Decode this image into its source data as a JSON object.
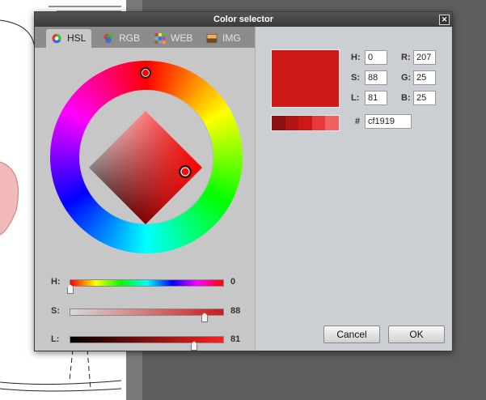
{
  "dialog": {
    "title": "Color selector",
    "close_label": "✕",
    "tabs": [
      {
        "label": "HSL",
        "active": true,
        "icon": "color-wheel-icon"
      },
      {
        "label": "RGB",
        "active": false,
        "icon": "rgb-circles-icon"
      },
      {
        "label": "WEB",
        "active": false,
        "icon": "web-palette-icon"
      },
      {
        "label": "IMG",
        "active": false,
        "icon": "image-icon"
      }
    ],
    "sliders": {
      "h": {
        "label": "H:",
        "value": "0"
      },
      "s": {
        "label": "S:",
        "value": "88"
      },
      "l": {
        "label": "L:",
        "value": "81"
      }
    },
    "fields": {
      "h": {
        "label": "H:",
        "value": "0"
      },
      "s": {
        "label": "S:",
        "value": "88"
      },
      "l": {
        "label": "L:",
        "value": "81"
      },
      "r": {
        "label": "R:",
        "value": "207"
      },
      "g": {
        "label": "G:",
        "value": "25"
      },
      "b": {
        "label": "B:",
        "value": "25"
      },
      "hex": {
        "label": "#",
        "value": "cf1919"
      }
    },
    "current_color": "#cf1919",
    "shades": [
      "#8e0f0f",
      "#b01414",
      "#cf1919",
      "#e83a3a",
      "#f26060"
    ],
    "buttons": {
      "cancel": "Cancel",
      "ok": "OK"
    }
  }
}
